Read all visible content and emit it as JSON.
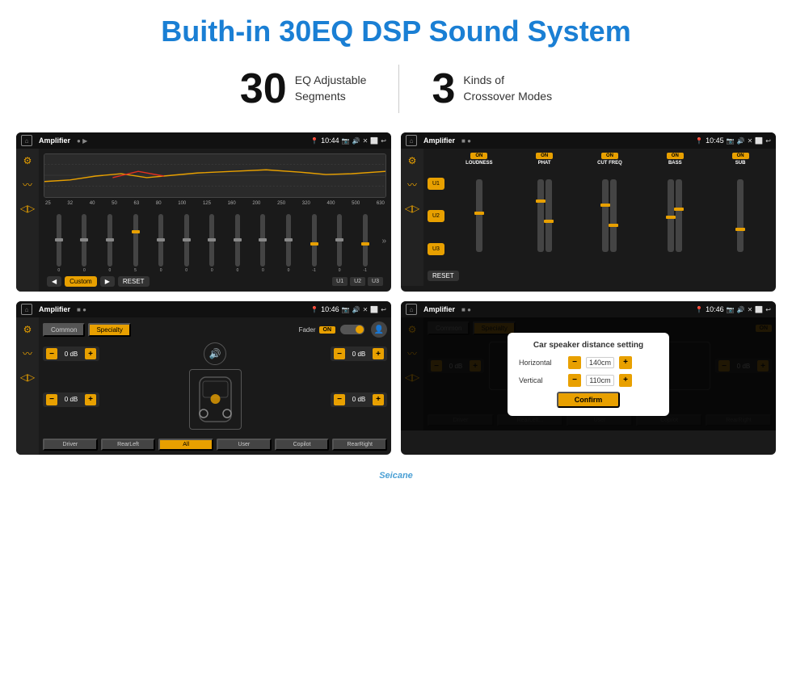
{
  "page": {
    "title": "Buith-in 30EQ DSP Sound System"
  },
  "stats": {
    "eq_number": "30",
    "eq_text_line1": "EQ Adjustable",
    "eq_text_line2": "Segments",
    "crossover_number": "3",
    "crossover_text_line1": "Kinds of",
    "crossover_text_line2": "Crossover Modes"
  },
  "screen1": {
    "title": "Amplifier",
    "time": "10:44",
    "freq_labels": [
      "25",
      "32",
      "40",
      "50",
      "63",
      "80",
      "100",
      "125",
      "160",
      "200",
      "250",
      "320",
      "400",
      "500",
      "630"
    ],
    "slider_values": [
      "0",
      "0",
      "0",
      "5",
      "0",
      "0",
      "0",
      "0",
      "0",
      "0",
      "-1",
      "0",
      "-1"
    ],
    "preset_btns": [
      "Custom",
      "RESET",
      "U1",
      "U2",
      "U3"
    ]
  },
  "screen2": {
    "title": "Amplifier",
    "time": "10:45",
    "channels": [
      "LOUDNESS",
      "PHAT",
      "CUT FREQ",
      "BASS",
      "SUB"
    ],
    "on_labels": [
      "ON",
      "ON",
      "ON",
      "ON",
      "ON"
    ],
    "u_labels": [
      "U1",
      "U2",
      "U3"
    ],
    "reset_label": "RESET"
  },
  "screen3": {
    "title": "Amplifier",
    "time": "10:46",
    "tabs": [
      "Common",
      "Specialty"
    ],
    "fader_label": "Fader",
    "on_label": "ON",
    "db_values": [
      "0 dB",
      "0 dB",
      "0 dB",
      "0 dB"
    ],
    "speaker_btns": [
      "Driver",
      "RearLeft",
      "All",
      "User",
      "Copilot",
      "RearRight"
    ]
  },
  "screen4": {
    "title": "Amplifier",
    "time": "10:46",
    "tabs": [
      "Common",
      "Specialty"
    ],
    "dialog_title": "Car speaker distance setting",
    "horizontal_label": "Horizontal",
    "horizontal_value": "140cm",
    "vertical_label": "Vertical",
    "vertical_value": "110cm",
    "confirm_label": "Confirm",
    "db_values": [
      "0 dB",
      "0 dB"
    ],
    "speaker_btns": [
      "Driver",
      "RearLeft...",
      "User",
      "Copilot",
      "RearRight"
    ]
  },
  "watermark": "Seicane"
}
